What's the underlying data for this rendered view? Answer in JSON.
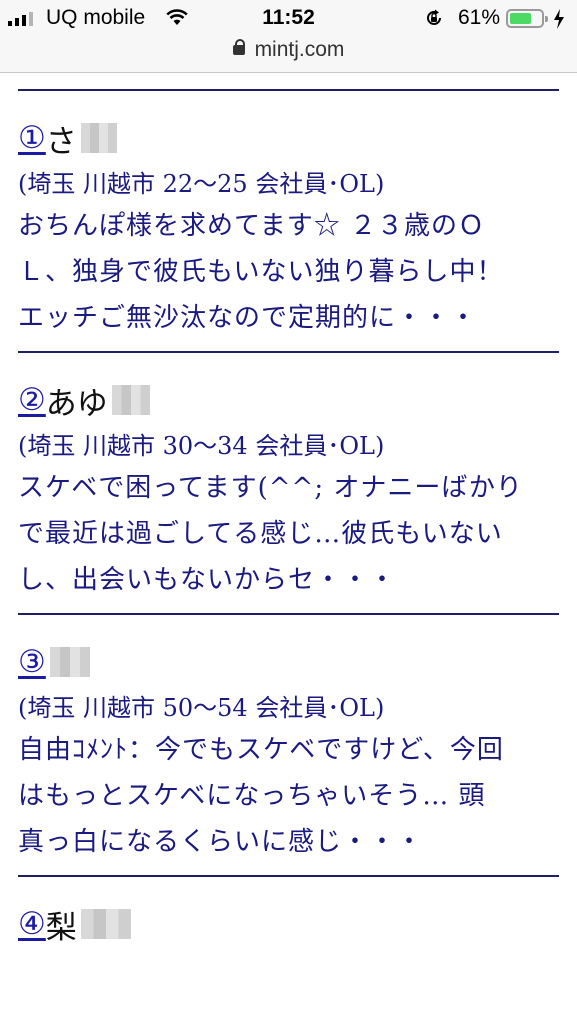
{
  "status_bar": {
    "carrier": "UQ mobile",
    "time": "11:52",
    "battery_percent": "61%",
    "battery_level": 0.61,
    "icons": [
      "signal-icon",
      "wifi-icon",
      "rotation-lock-icon",
      "battery-icon",
      "charging-icon"
    ]
  },
  "browser": {
    "url": "mintj.com",
    "icon": "padlock-icon"
  },
  "colors": {
    "text": "#1a1a80",
    "link": "#1a1aa6",
    "rule": "#1f1f66",
    "battery": "#4cd964"
  },
  "entries": [
    {
      "num": "①",
      "name": "さ",
      "meta": "(埼玉 川越市 22〜25 会社員･OL)",
      "lines": [
        "おちんぽ様を求めてます☆ ２３歳のＯ",
        "Ｌ、独身で彼氏もいない独り暮らし中！",
        "エッチご無沙汰なので定期的に・・・"
      ]
    },
    {
      "num": "②",
      "name": "あゆ",
      "meta": "(埼玉 川越市 30〜34 会社員･OL)",
      "lines": [
        "スケベで困ってます(^^; オナニーばかり",
        "で最近は過ごしてる感じ…彼氏もいない",
        "し、出会いもないからセ・・・"
      ]
    },
    {
      "num": "③",
      "name": "",
      "meta": "(埼玉 川越市 50〜54 会社員･OL)",
      "lines": [
        "自由ｺﾒﾝﾄ：今でもスケベですけど、今回",
        "はもっとスケベになっちゃいそう… 頭",
        "真っ白になるくらいに感じ・・・"
      ]
    },
    {
      "num": "④",
      "name": "梨"
    }
  ]
}
